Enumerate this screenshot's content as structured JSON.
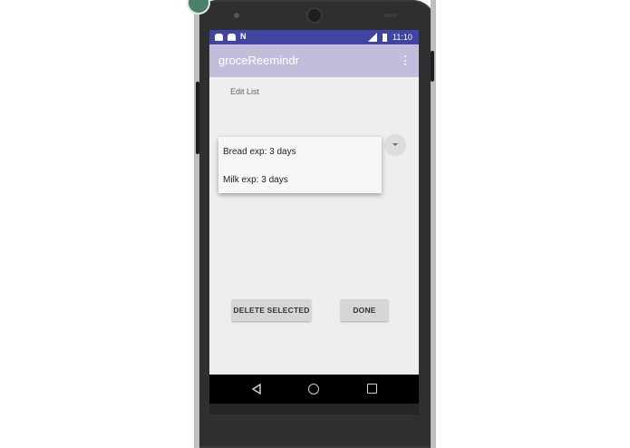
{
  "status_bar": {
    "left_icons": [
      "notification-icon",
      "notification-icon",
      "n-icon"
    ],
    "n_glyph": "N",
    "network": "3G",
    "time": "11:10"
  },
  "app_bar": {
    "title": "groceReemindr",
    "overflow_icon": "more-vertical-icon"
  },
  "edit_list": {
    "label": "Edit List"
  },
  "dropdown": {
    "items": [
      {
        "label": "Bread exp: 3 days"
      },
      {
        "label": "Milk exp: 3 days"
      }
    ]
  },
  "buttons": {
    "delete_label": "DELETE SELECTED",
    "done_label": "DONE"
  },
  "nav_bar": {
    "icons": [
      "back-icon",
      "home-icon",
      "recents-icon"
    ]
  },
  "colors": {
    "status_bar": "#3f45a0",
    "app_bar": "#c3bddc",
    "screen_bg": "#eeeeee",
    "button_bg": "#d6d6d6"
  }
}
